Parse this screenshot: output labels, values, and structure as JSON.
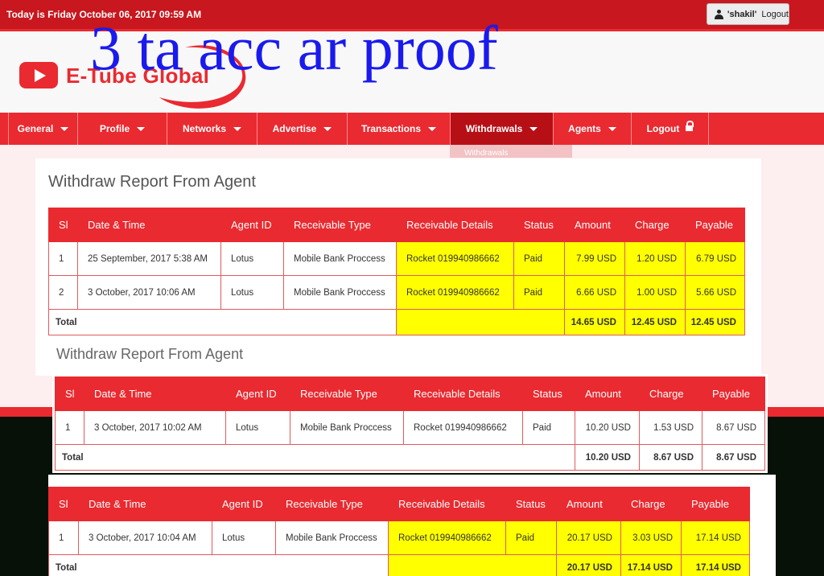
{
  "topbar": {
    "date_text": "Today is Friday October 06, 2017 09:59 AM",
    "user": "'shakil'",
    "logout_label": "Logout"
  },
  "header": {
    "logo_text": "E-Tube Global",
    "overlay_text": "3 ta acc ar proof"
  },
  "nav": {
    "items": [
      {
        "label": "General",
        "icon": "chevron-down-icon"
      },
      {
        "label": "Profile",
        "icon": "chevron-down-icon"
      },
      {
        "label": "Networks",
        "icon": "chevron-down-icon"
      },
      {
        "label": "Advertise",
        "icon": "chevron-down-icon"
      },
      {
        "label": "Transactions",
        "icon": "chevron-down-icon"
      },
      {
        "label": "Withdrawals",
        "icon": "chevron-down-icon"
      },
      {
        "label": "Agents",
        "icon": "chevron-down-icon"
      },
      {
        "label": "Logout",
        "icon": "lock-icon"
      }
    ],
    "dropdown_item": "Withdrawals"
  },
  "page": {
    "title": "Withdraw Report From Agent",
    "ghost_title": "Withdraw Report From Agent"
  },
  "columns": [
    "Sl",
    "Date & Time",
    "Agent ID",
    "Receivable Type",
    "Receivable Details",
    "Status",
    "Amount",
    "Charge",
    "Payable"
  ],
  "total_label": "Total",
  "reports": [
    {
      "rows": [
        {
          "sl": "1",
          "date": "25 September, 2017 5:38 AM",
          "agent": "Lotus",
          "type": "Mobile Bank Proccess",
          "details": "Rocket 019940986662",
          "status": "Paid",
          "amount": "7.99 USD",
          "charge": "1.20 USD",
          "payable": "6.79 USD"
        },
        {
          "sl": "2",
          "date": "3 October, 2017 10:06 AM",
          "agent": "Lotus",
          "type": "Mobile Bank Proccess",
          "details": "Rocket 019940986662",
          "status": "Paid",
          "amount": "6.66 USD",
          "charge": "1.00 USD",
          "payable": "5.66 USD"
        }
      ],
      "total": {
        "amount": "14.65 USD",
        "charge": "12.45 USD",
        "payable": "12.45 USD"
      }
    },
    {
      "rows": [
        {
          "sl": "1",
          "date": "3 October, 2017 10:02 AM",
          "agent": "Lotus",
          "type": "Mobile Bank Proccess",
          "details": "Rocket 019940986662",
          "status": "Paid",
          "amount": "10.20 USD",
          "charge": "1.53 USD",
          "payable": "8.67 USD"
        }
      ],
      "total": {
        "amount": "10.20 USD",
        "charge": "8.67 USD",
        "payable": "8.67 USD"
      }
    },
    {
      "rows": [
        {
          "sl": "1",
          "date": "3 October, 2017 10:04 AM",
          "agent": "Lotus",
          "type": "Mobile Bank Proccess",
          "details": "Rocket 019940986662",
          "status": "Paid",
          "amount": "20.17 USD",
          "charge": "3.03 USD",
          "payable": "17.14 USD"
        }
      ],
      "total": {
        "amount": "20.17 USD",
        "charge": "17.14 USD",
        "payable": "17.14 USD"
      }
    }
  ],
  "colors": {
    "brand_red": "#e92a30",
    "highlight": "#ffff00",
    "overlay_blue": "#1a1aee"
  }
}
